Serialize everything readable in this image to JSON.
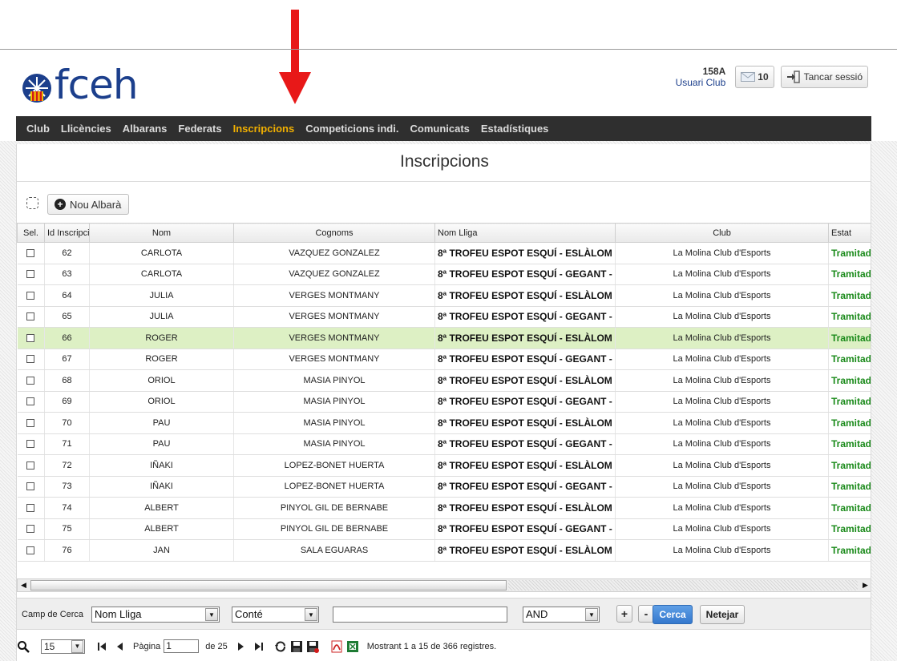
{
  "brand": {
    "logo_text": "fceh"
  },
  "user": {
    "code": "158A",
    "role": "Usuari Club",
    "messages_count": "10",
    "logout_label": "Tancar sessió"
  },
  "nav": {
    "items": [
      "Club",
      "Llicències",
      "Albarans",
      "Federats",
      "Inscripcions",
      "Competicions indi.",
      "Comunicats",
      "Estadístiques"
    ],
    "active_index": 4
  },
  "page": {
    "title": "Inscripcions",
    "new_button_label": "Nou Albarà"
  },
  "table": {
    "columns": [
      "Sel.",
      "Id Inscripcio",
      "Nom",
      "Cognoms",
      "Nom Lliga",
      "Club",
      "Estat"
    ],
    "highlighted_row_index": 4,
    "rows": [
      [
        "62",
        "CARLOTA",
        "VAZQUEZ GONZALEZ",
        "8ª TROFEU ESPOT ESQUÍ - ESLÀLOM",
        "La Molina Club d'Esports",
        "Tramitada"
      ],
      [
        "63",
        "CARLOTA",
        "VAZQUEZ GONZALEZ",
        "8ª TROFEU ESPOT ESQUÍ - GEGANT -",
        "La Molina Club d'Esports",
        "Tramitada"
      ],
      [
        "64",
        "JULIA",
        "VERGES MONTMANY",
        "8ª TROFEU ESPOT ESQUÍ - ESLÀLOM",
        "La Molina Club d'Esports",
        "Tramitada"
      ],
      [
        "65",
        "JULIA",
        "VERGES MONTMANY",
        "8ª TROFEU ESPOT ESQUÍ - GEGANT -",
        "La Molina Club d'Esports",
        "Tramitada"
      ],
      [
        "66",
        "ROGER",
        "VERGES MONTMANY",
        "8ª TROFEU ESPOT ESQUÍ - ESLÀLOM",
        "La Molina Club d'Esports",
        "Tramitada"
      ],
      [
        "67",
        "ROGER",
        "VERGES MONTMANY",
        "8ª TROFEU ESPOT ESQUÍ - GEGANT -",
        "La Molina Club d'Esports",
        "Tramitada"
      ],
      [
        "68",
        "ORIOL",
        "MASIA PINYOL",
        "8ª TROFEU ESPOT ESQUÍ - ESLÀLOM",
        "La Molina Club d'Esports",
        "Tramitada"
      ],
      [
        "69",
        "ORIOL",
        "MASIA PINYOL",
        "8ª TROFEU ESPOT ESQUÍ - GEGANT -",
        "La Molina Club d'Esports",
        "Tramitada"
      ],
      [
        "70",
        "PAU",
        "MASIA PINYOL",
        "8ª TROFEU ESPOT ESQUÍ - ESLÀLOM",
        "La Molina Club d'Esports",
        "Tramitada"
      ],
      [
        "71",
        "PAU",
        "MASIA PINYOL",
        "8ª TROFEU ESPOT ESQUÍ - GEGANT -",
        "La Molina Club d'Esports",
        "Tramitada"
      ],
      [
        "72",
        "IÑAKI",
        "LOPEZ-BONET HUERTA",
        "8ª TROFEU ESPOT ESQUÍ - ESLÀLOM",
        "La Molina Club d'Esports",
        "Tramitada"
      ],
      [
        "73",
        "IÑAKI",
        "LOPEZ-BONET HUERTA",
        "8ª TROFEU ESPOT ESQUÍ - GEGANT -",
        "La Molina Club d'Esports",
        "Tramitada"
      ],
      [
        "74",
        "ALBERT",
        "PINYOL GIL DE BERNABE",
        "8ª TROFEU ESPOT ESQUÍ - ESLÀLOM",
        "La Molina Club d'Esports",
        "Tramitada"
      ],
      [
        "75",
        "ALBERT",
        "PINYOL GIL DE BERNABE",
        "8ª TROFEU ESPOT ESQUÍ - GEGANT -",
        "La Molina Club d'Esports",
        "Tramitada"
      ],
      [
        "76",
        "JAN",
        "SALA EGUARAS",
        "8ª TROFEU ESPOT ESQUÍ - ESLÀLOM",
        "La Molina Club d'Esports",
        "Tramitada"
      ]
    ]
  },
  "search": {
    "label": "Camp de Cerca",
    "field_value": "Nom Lliga",
    "operator_value": "Conté",
    "text_value": "",
    "logic_value": "AND",
    "add_label": "+",
    "remove_label": "-",
    "search_label": "Cerca",
    "clear_label": "Netejar"
  },
  "pager": {
    "page_size": "15",
    "page_label": "Pàgina",
    "current_page": "1",
    "total_pages_label": "de 25",
    "status": "Mostrant 1 a 15 de 366 registres."
  },
  "colors": {
    "nav_bg": "#2f2f2f",
    "nav_active": "#f2b000",
    "brand_blue": "#1c3f8c",
    "status_green": "#1a8a1a",
    "highlight_row": "#ddf0c4",
    "annotation_red": "#e81818"
  },
  "icons": [
    "crest-icon",
    "envelope-icon",
    "logout-icon",
    "plus-circle-icon",
    "search-icon",
    "first-page-icon",
    "prev-page-icon",
    "next-page-icon",
    "last-page-icon",
    "refresh-icon",
    "save-icon",
    "save-as-icon",
    "pdf-icon",
    "excel-icon",
    "arrow-annotation-icon"
  ]
}
